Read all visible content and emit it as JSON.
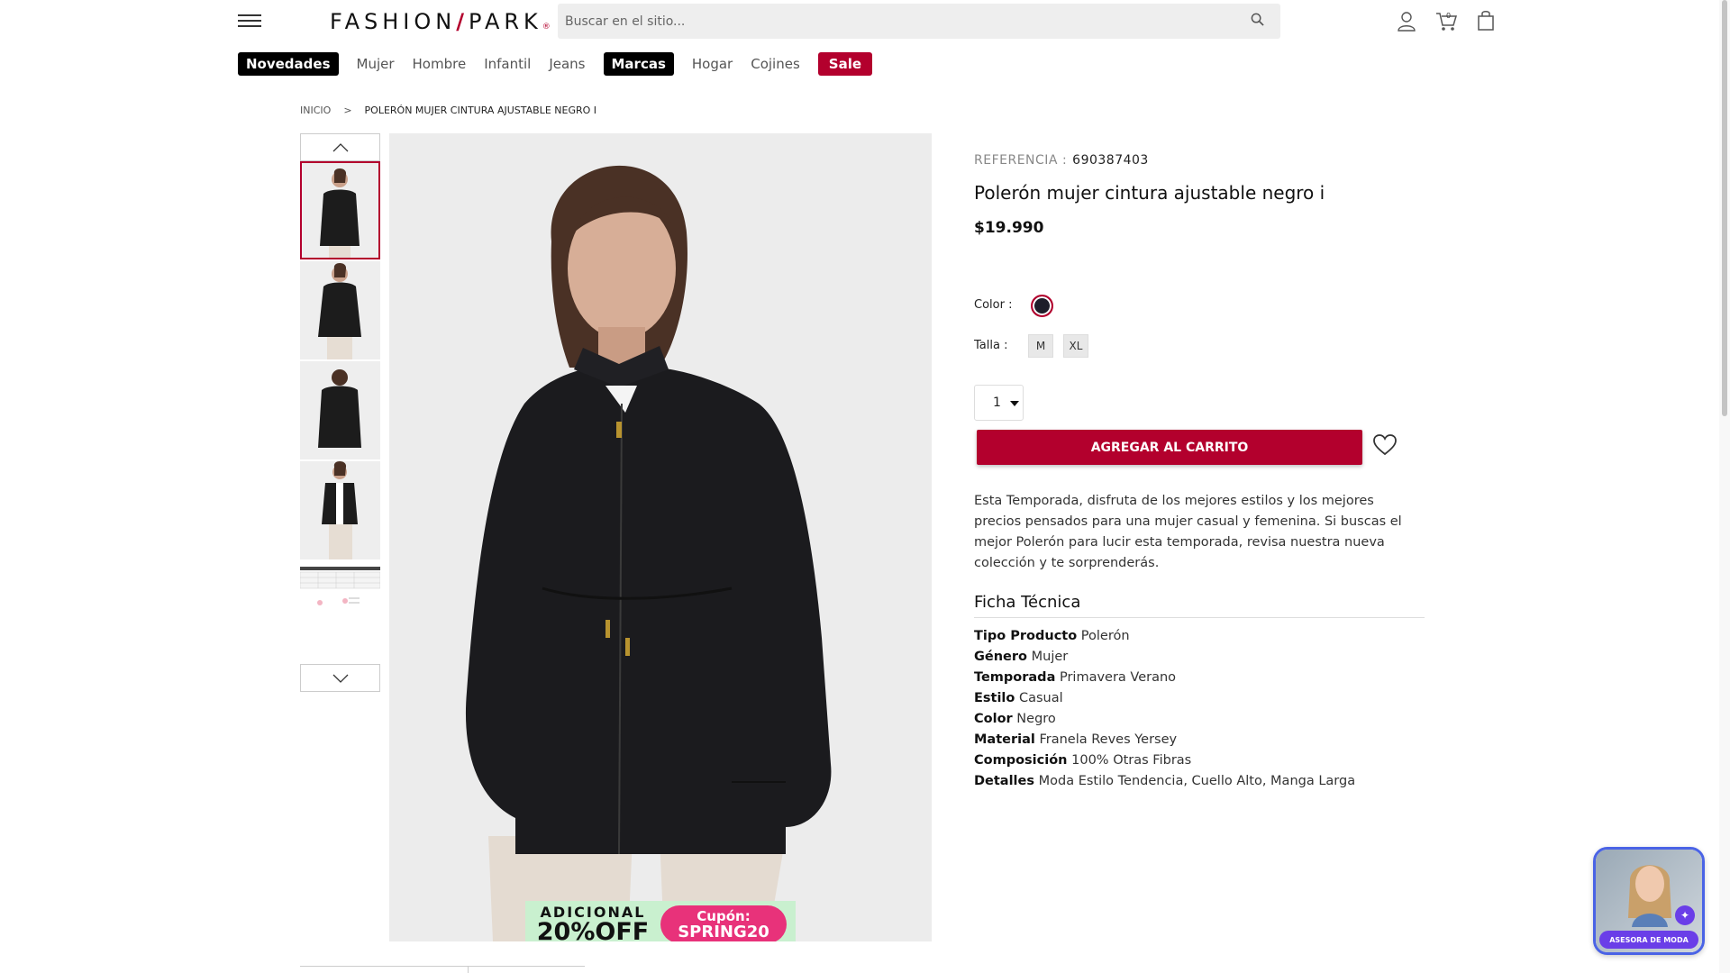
{
  "header": {
    "logo_text": "FASHION",
    "logo_slash": "/",
    "logo_text2": "PARK",
    "search_placeholder": "Buscar en el sitio...",
    "cart_count": "0"
  },
  "nav": {
    "items": [
      {
        "label": "Novedades",
        "style": "pill"
      },
      {
        "label": "Mujer",
        "style": "plain"
      },
      {
        "label": "Hombre",
        "style": "plain"
      },
      {
        "label": "Infantil",
        "style": "plain"
      },
      {
        "label": "Jeans",
        "style": "plain"
      },
      {
        "label": "Marcas",
        "style": "pill"
      },
      {
        "label": "Hogar",
        "style": "plain"
      },
      {
        "label": "Cojines",
        "style": "plain"
      },
      {
        "label": "Sale",
        "style": "sale"
      }
    ]
  },
  "breadcrumb": {
    "home": "INICIO",
    "separator": ">",
    "current": "POLERÓN MUJER CINTURA AJUSTABLE NEGRO I"
  },
  "gallery": {
    "promo_line1": "ADICIONAL",
    "promo_line2": "20%OFF",
    "promo_coupon_label": "Cupón:",
    "promo_coupon_code": "SPRING20"
  },
  "product": {
    "ref_label": "REFERENCIA :",
    "ref_value": "690387403",
    "title": "Polerón mujer cintura ajustable negro i",
    "price": "$19.990",
    "color_label": "Color :",
    "color_hex": "#1e1e2a",
    "size_label": "Talla :",
    "sizes": [
      "M",
      "XL"
    ],
    "quantity": "1",
    "add_to_cart": "AGREGAR AL CARRITO",
    "description": "Esta Temporada, disfruta de los mejores estilos y los mejores precios pensados para una mujer casual y femenina. Si buscas el mejor Polerón para lucir esta temporada, revisa nuestra nueva colección y te sorprenderás."
  },
  "ficha": {
    "title": "Ficha Técnica",
    "rows": [
      {
        "key": "Tipo Producto",
        "value": "Polerón"
      },
      {
        "key": "Género",
        "value": "Mujer"
      },
      {
        "key": "Temporada",
        "value": "Primavera Verano"
      },
      {
        "key": "Estilo",
        "value": "Casual"
      },
      {
        "key": "Color",
        "value": "Negro"
      },
      {
        "key": "Material",
        "value": "Franela Reves Yersey"
      },
      {
        "key": "Composición",
        "value": "100% Otras Fibras"
      },
      {
        "key": "Detalles",
        "value": "Moda Estilo Tendencia, Cuello Alto, Manga Larga"
      }
    ]
  },
  "chat": {
    "label": "ASESORA DE MODA"
  },
  "colors": {
    "brand": "#b3002d",
    "chat_accent": "#6a3ee8"
  }
}
